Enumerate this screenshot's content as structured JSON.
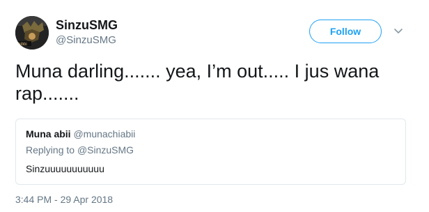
{
  "author": {
    "display_name": "SinzuSMG",
    "handle": "@SinzuSMG",
    "avatar_badge": "hibbi"
  },
  "follow_button": {
    "label": "Follow"
  },
  "more_menu": {
    "icon": "chevron-down-icon"
  },
  "tweet": {
    "text": "Muna darling....... yea, I’m out..... I jus wana rap.......",
    "timestamp": "3:44 PM - 29 Apr 2018"
  },
  "quoted_tweet": {
    "display_name": "Muna abii",
    "handle": "@munachiabii",
    "replying_prefix": "Replying to",
    "replying_to": "@SinzuSMG",
    "text": "Sinzuuuuuuuuuuu"
  },
  "colors": {
    "accent": "#1da1f2",
    "secondary_text": "#657786",
    "primary_text": "#14171a",
    "border": "#e1e8ed"
  }
}
